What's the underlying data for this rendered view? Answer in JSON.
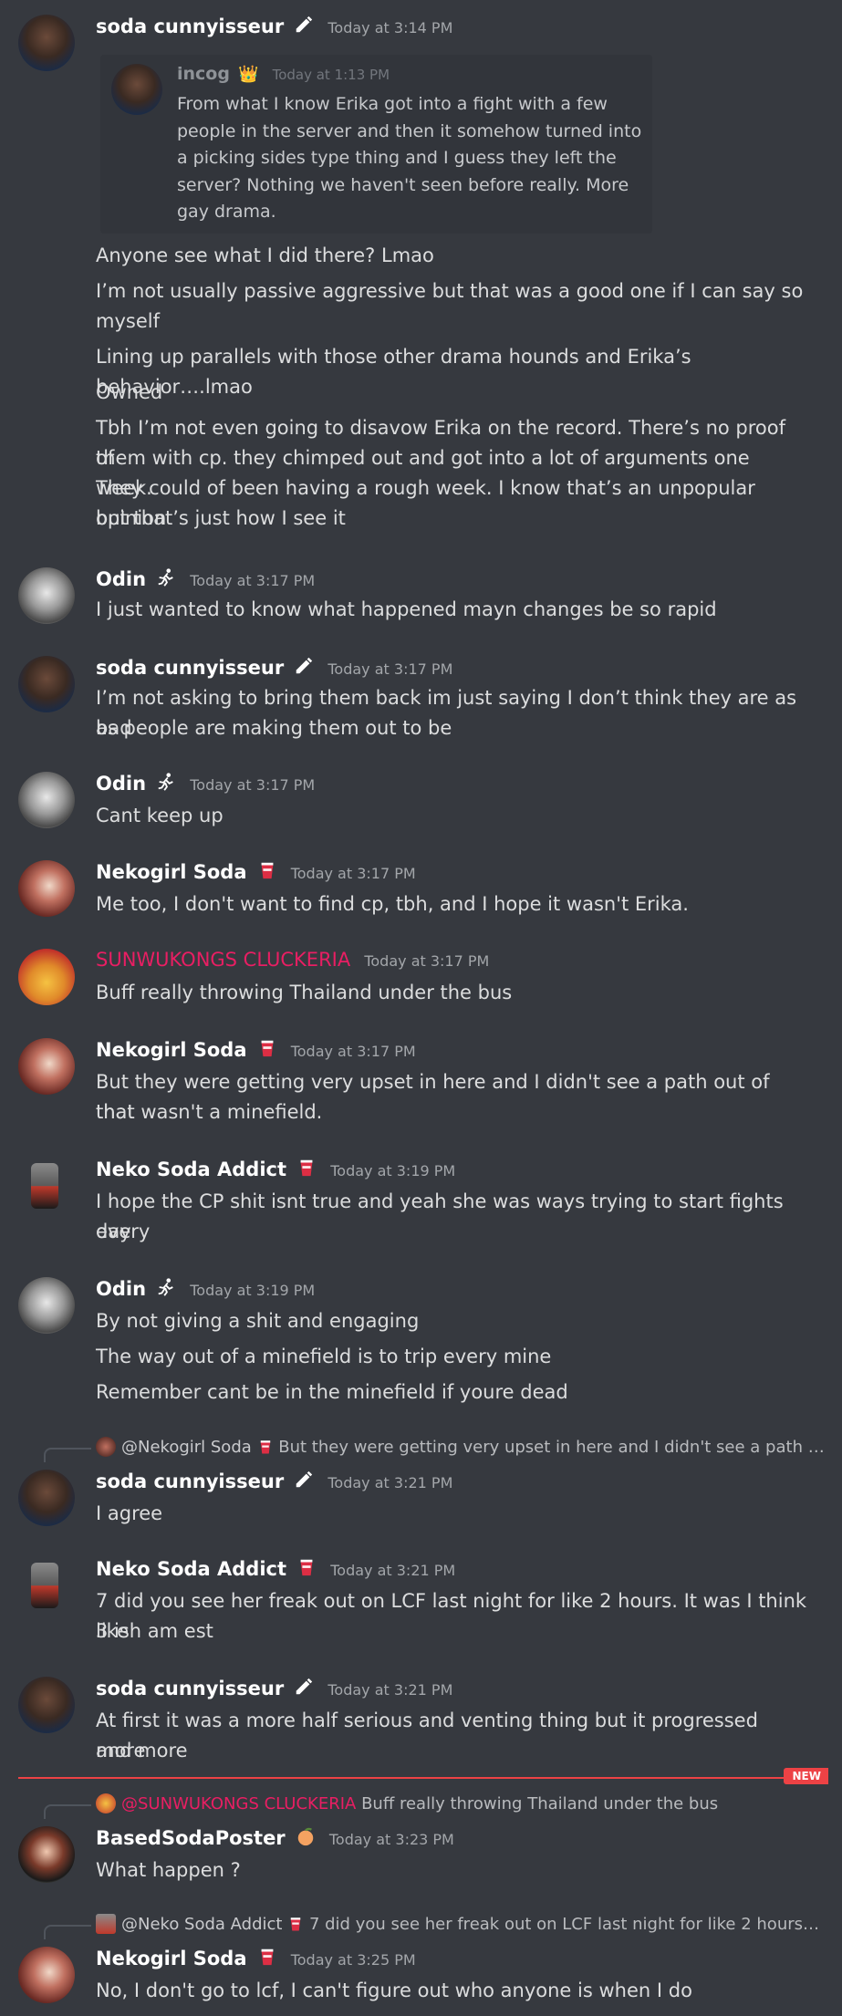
{
  "colors": {
    "background": "#36393f",
    "timestamp": "#a3a6aa",
    "text": "#dcddde",
    "sunwukongs": "#e91e63",
    "new_divider": "#ed4245",
    "quote_name": "#8e9297"
  },
  "new_label": "NEW",
  "messages": {
    "m1": {
      "user": "soda cunnyisseur",
      "badge": "pen-icon",
      "ts": "Today at 3:14 PM",
      "quote": {
        "user": "incog",
        "crown": "👑",
        "ts": "Today at 1:13 PM",
        "lines": [
          "From what I know Erika got into a fight with a few",
          "people in the server and then it somehow turned into",
          "a picking sides type thing and I guess they left the",
          "server? Nothing we haven't seen before really. More",
          "gay drama."
        ]
      },
      "lines": [
        "Anyone see what I did there? Lmao",
        "I’m not usually passive aggressive but that was a good one if I can say so",
        "myself",
        "Lining up parallels with those other drama hounds and Erika’s behavior….lmao",
        "Owned",
        "Tbh I’m not even going to disavow Erika on the record. There’s no proof of",
        "them with cp. they chimped out and got into a lot of arguments one week.",
        "They could of been having a rough week. I know that’s an unpopular opinion",
        "but that’s just how I see it"
      ]
    },
    "m2": {
      "user": "Odin",
      "ts": "Today at 3:17 PM",
      "lines": [
        "I just wanted to know what happened mayn changes be so rapid"
      ]
    },
    "m3": {
      "user": "soda cunnyisseur",
      "ts": "Today at 3:17 PM",
      "lines": [
        "I’m not asking to bring them back im just saying I don’t think they are as bad",
        "as people are making them out to be"
      ]
    },
    "m4": {
      "user": "Odin",
      "ts": "Today at 3:17 PM",
      "lines": [
        "Cant keep up"
      ]
    },
    "m5": {
      "user": "Nekogirl Soda",
      "ts": "Today at 3:17 PM",
      "lines": [
        "Me too, I don't want to find cp, tbh, and I hope it wasn't Erika."
      ]
    },
    "m6": {
      "user": "SUNWUKONGS CLUCKERIA",
      "ts": "Today at 3:17 PM",
      "lines": [
        "Buff really throwing Thailand under the bus"
      ]
    },
    "m7": {
      "user": "Nekogirl Soda",
      "ts": "Today at 3:17 PM",
      "lines": [
        "But they were getting very upset in here and I didn't see a path out of that",
        "that wasn't a minefield."
      ]
    },
    "m8": {
      "user": "Neko Soda Addict",
      "ts": "Today at 3:19 PM",
      "lines": [
        "I hope the CP shit isnt true and yeah she was ways trying to start fights every",
        "day"
      ]
    },
    "m9": {
      "user": "Odin",
      "ts": "Today at 3:19 PM",
      "lines": [
        "By not giving a shit and engaging",
        "The way out of a minefield is to trip every mine",
        "Remember cant be in the minefield if youre dead"
      ]
    },
    "m10": {
      "reply_to": "@Nekogirl Soda",
      "reply_text": "But they were getting very upset in here and I didn't see a path …",
      "user": "soda cunnyisseur",
      "ts": "Today at 3:21 PM",
      "lines": [
        "I agree"
      ]
    },
    "m11": {
      "user": "Neko Soda Addict",
      "ts": "Today at 3:21 PM",
      "lines": [
        "7 did you see her freak out on LCF last night for like 2 hours. It was I think like",
        "3 ish am est"
      ]
    },
    "m12": {
      "user": "soda cunnyisseur",
      "ts": "Today at 3:21 PM",
      "lines": [
        "At first it was a more half serious and venting thing but it progressed more",
        "and more"
      ]
    },
    "m13": {
      "reply_to": "@SUNWUKONGS CLUCKERIA",
      "reply_text": "Buff really throwing Thailand under the bus",
      "user": "BasedSodaPoster",
      "badge_emoji": "🍑",
      "ts": "Today at 3:23 PM",
      "lines": [
        "What happen ?"
      ]
    },
    "m14": {
      "reply_to": "@Neko Soda Addict",
      "reply_text": "7 did you see her freak out on LCF last night for like 2 hours…",
      "user": "Nekogirl Soda",
      "ts": "Today at 3:25 PM",
      "lines": [
        "No, I don't go to lcf, I can't figure out who anyone is when I do"
      ]
    }
  }
}
